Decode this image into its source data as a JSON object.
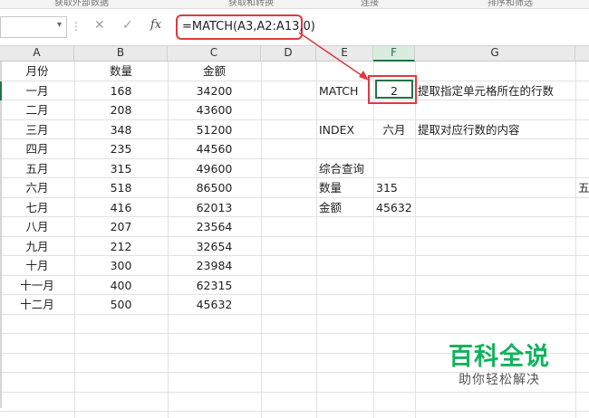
{
  "ribbon_strip": [
    "获取外部数据",
    "获取和转换",
    "连接",
    "排序和筛选"
  ],
  "formula_bar": {
    "name_box_value": "",
    "cancel_icon": "close-icon",
    "enter_icon": "check-icon",
    "fx_label": "fx",
    "formula": "=MATCH(A3,A2:A13,0)"
  },
  "columns": [
    "A",
    "B",
    "C",
    "D",
    "E",
    "F",
    "G"
  ],
  "selected_column": "F",
  "table": {
    "header": [
      "月份",
      "数量",
      "金额"
    ],
    "rows": [
      [
        "一月",
        "168",
        "34200"
      ],
      [
        "二月",
        "208",
        "43600"
      ],
      [
        "三月",
        "348",
        "51200"
      ],
      [
        "四月",
        "235",
        "44560"
      ],
      [
        "五月",
        "315",
        "49600"
      ],
      [
        "六月",
        "518",
        "86500"
      ],
      [
        "七月",
        "416",
        "62013"
      ],
      [
        "八月",
        "207",
        "23564"
      ],
      [
        "九月",
        "212",
        "32654"
      ],
      [
        "十月",
        "300",
        "23984"
      ],
      [
        "十一月",
        "400",
        "62315"
      ],
      [
        "十二月",
        "500",
        "45632"
      ]
    ]
  },
  "lookup": {
    "match_label": "MATCH",
    "match_value": "2",
    "match_desc": "提取指定单元格所在的行数",
    "index_label": "INDEX",
    "index_value": "六月",
    "index_desc": "提取对应行数的内容",
    "combo_label": "综合查询",
    "qty_label": "数量",
    "qty_value": "315",
    "amount_label": "金额",
    "amount_value": "45632",
    "edge_text": "五"
  },
  "watermark": {
    "main": "百科全说",
    "sub": "助你轻松解决"
  },
  "colors": {
    "highlight_red": "#e0393e",
    "excel_green": "#217346",
    "watermark_green": "#12b35c"
  }
}
